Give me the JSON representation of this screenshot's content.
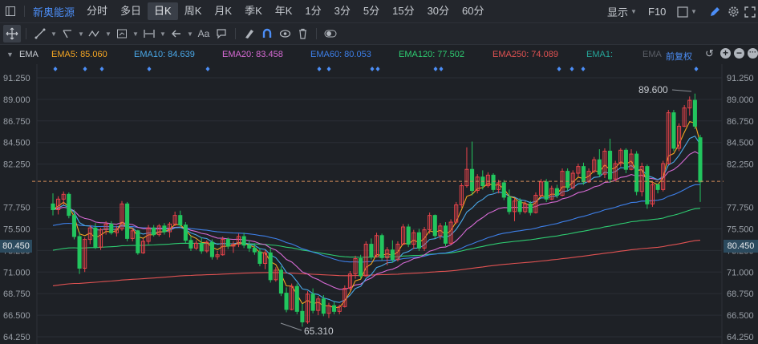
{
  "toolbar": {
    "stock_name": "新奥能源",
    "periods": [
      "分时",
      "多日",
      "日K",
      "周K",
      "月K",
      "季K",
      "年K",
      "1分",
      "3分",
      "5分",
      "15分",
      "30分",
      "60分"
    ],
    "active_period": "日K",
    "display_label": "显示",
    "f10_label": "F10",
    "text_tool_label": "Aa"
  },
  "ema_bar": {
    "indicator": "EMA",
    "items": [
      {
        "label": "EMA5: 85.060",
        "color": "#f5a623"
      },
      {
        "label": "EMA10: 84.639",
        "color": "#4aa8e8"
      },
      {
        "label": "EMA20: 83.458",
        "color": "#d86bd6"
      },
      {
        "label": "EMA60: 80.053",
        "color": "#3d7fe8"
      },
      {
        "label": "EMA120: 77.502",
        "color": "#2ecc71"
      },
      {
        "label": "EMA250: 74.089",
        "color": "#e05252"
      },
      {
        "label": "EMA1:",
        "color": "#26a69a"
      },
      {
        "label": "EMA",
        "color": "#5a5e66"
      }
    ],
    "adjust_label": "前复权"
  },
  "price_axis": {
    "ticks": [
      "91.250",
      "89.000",
      "86.750",
      "84.500",
      "82.250",
      "80.450",
      "77.750",
      "75.500",
      "73.250",
      "71.000",
      "68.750",
      "66.500",
      "64.250"
    ],
    "current_price": "80.450"
  },
  "annotations": {
    "high": "89.600",
    "low": "65.310"
  },
  "colors": {
    "up": "#e8434a",
    "down": "#22c55e",
    "background": "#1e2126",
    "accent": "#4c8ef7"
  },
  "chart_data": {
    "type": "candlestick",
    "ylim": [
      63.5,
      92.5
    ],
    "ohlc": [
      [
        78.1,
        79.2,
        76.9,
        77.5
      ],
      [
        77.5,
        78.9,
        77.0,
        78.6
      ],
      [
        78.6,
        79.4,
        78.0,
        79.1
      ],
      [
        79.1,
        79.3,
        76.6,
        76.9
      ],
      [
        76.9,
        77.5,
        74.4,
        74.7
      ],
      [
        74.7,
        75.2,
        70.8,
        71.4
      ],
      [
        71.4,
        74.6,
        71.0,
        74.4
      ],
      [
        74.4,
        75.9,
        73.9,
        75.6
      ],
      [
        75.6,
        76.1,
        73.4,
        73.6
      ],
      [
        73.6,
        75.6,
        73.3,
        75.4
      ],
      [
        75.4,
        76.3,
        74.9,
        76.0
      ],
      [
        76.0,
        76.3,
        74.9,
        75.1
      ],
      [
        75.1,
        75.8,
        74.7,
        75.5
      ],
      [
        75.5,
        78.4,
        75.3,
        78.1
      ],
      [
        78.1,
        78.3,
        74.2,
        74.5
      ],
      [
        74.5,
        75.6,
        74.2,
        75.3
      ],
      [
        75.3,
        75.4,
        72.8,
        73.0
      ],
      [
        73.0,
        74.5,
        72.9,
        74.2
      ],
      [
        74.2,
        75.9,
        73.9,
        75.6
      ],
      [
        75.6,
        75.9,
        74.7,
        74.9
      ],
      [
        74.9,
        76.0,
        74.7,
        75.8
      ],
      [
        75.8,
        76.1,
        74.9,
        75.2
      ],
      [
        75.2,
        76.2,
        74.6,
        76.0
      ],
      [
        76.0,
        77.3,
        75.8,
        76.9
      ],
      [
        76.9,
        77.4,
        75.6,
        75.9
      ],
      [
        75.9,
        76.2,
        74.0,
        74.3
      ],
      [
        74.3,
        74.8,
        73.2,
        73.5
      ],
      [
        73.5,
        74.3,
        73.3,
        74.0
      ],
      [
        74.0,
        74.6,
        72.9,
        73.2
      ],
      [
        73.2,
        74.3,
        73.0,
        74.1
      ],
      [
        74.1,
        74.4,
        72.3,
        72.6
      ],
      [
        72.6,
        73.2,
        72.3,
        72.8
      ],
      [
        72.8,
        74.7,
        72.7,
        74.4
      ],
      [
        74.4,
        74.6,
        73.4,
        73.7
      ],
      [
        73.7,
        74.2,
        73.0,
        73.9
      ],
      [
        73.9,
        75.0,
        73.6,
        74.7
      ],
      [
        74.7,
        75.1,
        73.5,
        73.8
      ],
      [
        73.8,
        74.3,
        73.1,
        73.5
      ],
      [
        73.5,
        74.0,
        72.8,
        73.1
      ],
      [
        73.1,
        73.5,
        71.6,
        71.9
      ],
      [
        71.9,
        73.3,
        71.3,
        73.0
      ],
      [
        73.0,
        73.6,
        69.9,
        70.2
      ],
      [
        70.2,
        71.5,
        70.0,
        71.2
      ],
      [
        71.2,
        71.6,
        68.5,
        68.8
      ],
      [
        68.8,
        69.4,
        66.8,
        67.1
      ],
      [
        67.1,
        69.8,
        67.0,
        69.5
      ],
      [
        69.5,
        69.8,
        66.6,
        66.9
      ],
      [
        66.9,
        67.7,
        65.3,
        65.8
      ],
      [
        65.8,
        69.0,
        65.6,
        68.7
      ],
      [
        68.7,
        69.3,
        66.7,
        67.0
      ],
      [
        67.0,
        68.5,
        66.5,
        68.2
      ],
      [
        68.2,
        68.6,
        66.4,
        66.7
      ],
      [
        66.7,
        67.8,
        66.2,
        67.5
      ],
      [
        67.5,
        67.9,
        66.6,
        66.9
      ],
      [
        66.9,
        67.6,
        66.6,
        67.4
      ],
      [
        67.4,
        69.6,
        67.3,
        69.3
      ],
      [
        69.3,
        71.1,
        69.1,
        70.8
      ],
      [
        70.8,
        72.7,
        70.3,
        72.4
      ],
      [
        72.4,
        72.8,
        70.3,
        70.6
      ],
      [
        70.6,
        74.2,
        70.5,
        73.9
      ],
      [
        73.9,
        74.5,
        72.3,
        72.6
      ],
      [
        72.6,
        75.1,
        72.5,
        74.8
      ],
      [
        74.8,
        75.0,
        72.2,
        72.5
      ],
      [
        72.5,
        73.6,
        71.7,
        73.3
      ],
      [
        73.3,
        74.3,
        72.0,
        72.3
      ],
      [
        72.3,
        74.2,
        72.1,
        73.9
      ],
      [
        73.9,
        76.0,
        73.8,
        75.7
      ],
      [
        75.7,
        76.0,
        73.6,
        73.9
      ],
      [
        73.9,
        75.4,
        73.4,
        75.1
      ],
      [
        75.1,
        75.5,
        73.2,
        73.5
      ],
      [
        73.5,
        75.7,
        73.2,
        75.4
      ],
      [
        75.4,
        77.2,
        75.0,
        76.9
      ],
      [
        76.9,
        77.0,
        74.5,
        74.8
      ],
      [
        74.8,
        76.1,
        74.4,
        75.8
      ],
      [
        75.8,
        76.2,
        73.7,
        74.0
      ],
      [
        74.0,
        76.5,
        73.9,
        76.2
      ],
      [
        76.2,
        78.3,
        76.0,
        78.0
      ],
      [
        78.0,
        80.3,
        77.7,
        80.0
      ],
      [
        80.0,
        84.0,
        79.8,
        81.7
      ],
      [
        81.7,
        84.6,
        79.0,
        79.5
      ],
      [
        79.5,
        81.2,
        79.2,
        80.9
      ],
      [
        80.9,
        81.6,
        79.6,
        80.0
      ],
      [
        80.0,
        81.4,
        79.8,
        81.1
      ],
      [
        81.1,
        81.3,
        79.3,
        79.6
      ],
      [
        79.6,
        80.6,
        79.2,
        80.3
      ],
      [
        80.3,
        80.6,
        78.5,
        78.8
      ],
      [
        78.8,
        79.6,
        77.0,
        77.3
      ],
      [
        77.3,
        78.7,
        76.3,
        78.4
      ],
      [
        78.4,
        78.7,
        77.0,
        77.3
      ],
      [
        77.3,
        78.4,
        77.1,
        78.1
      ],
      [
        78.1,
        78.4,
        76.9,
        77.2
      ],
      [
        77.2,
        79.3,
        77.1,
        79.0
      ],
      [
        79.0,
        80.7,
        78.8,
        80.4
      ],
      [
        80.4,
        80.7,
        78.3,
        78.6
      ],
      [
        78.6,
        80.0,
        78.5,
        79.7
      ],
      [
        79.7,
        80.1,
        78.7,
        79.0
      ],
      [
        79.0,
        81.8,
        78.9,
        81.5
      ],
      [
        81.5,
        81.8,
        79.5,
        79.8
      ],
      [
        79.8,
        81.6,
        79.6,
        81.3
      ],
      [
        81.3,
        82.3,
        80.9,
        82.0
      ],
      [
        82.0,
        82.4,
        80.1,
        80.4
      ],
      [
        80.4,
        81.8,
        80.3,
        81.5
      ],
      [
        81.5,
        83.0,
        81.3,
        82.7
      ],
      [
        82.7,
        83.8,
        80.9,
        81.2
      ],
      [
        81.2,
        83.9,
        80.8,
        83.6
      ],
      [
        83.6,
        84.9,
        80.3,
        80.7
      ],
      [
        80.7,
        82.6,
        80.4,
        82.3
      ],
      [
        82.3,
        83.9,
        82.0,
        83.7
      ],
      [
        83.7,
        83.9,
        81.3,
        81.7
      ],
      [
        81.7,
        83.8,
        81.6,
        83.3
      ],
      [
        83.3,
        83.6,
        79.0,
        79.4
      ],
      [
        79.4,
        82.4,
        78.9,
        82.0
      ],
      [
        82.0,
        82.2,
        77.6,
        78.1
      ],
      [
        78.1,
        80.4,
        77.8,
        80.1
      ],
      [
        80.1,
        80.2,
        79.2,
        79.6
      ],
      [
        79.6,
        82.6,
        79.4,
        82.3
      ],
      [
        82.3,
        87.9,
        82.2,
        87.6
      ],
      [
        87.6,
        87.9,
        83.6,
        83.9
      ],
      [
        83.9,
        86.5,
        83.6,
        86.2
      ],
      [
        86.2,
        88.4,
        86.1,
        88.1
      ],
      [
        88.1,
        89.3,
        87.3,
        88.9
      ],
      [
        88.9,
        89.6,
        85.9,
        86.2
      ],
      [
        85.0,
        85.3,
        78.3,
        80.4
      ]
    ]
  }
}
